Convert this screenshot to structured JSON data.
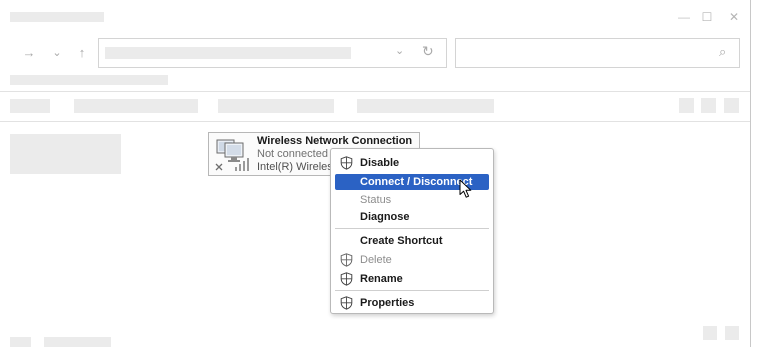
{
  "titlebar": {
    "minimize_glyph": "—",
    "maximize_glyph": "☐",
    "close_glyph": "✕"
  },
  "navigation": {
    "forward_glyph": "→",
    "recent_glyph": "⌄",
    "up_glyph": "↑",
    "dropdown_glyph": "⌄",
    "refresh_glyph": "↻",
    "search_glyph": "⌕"
  },
  "network": {
    "name": "Wireless Network Connection",
    "status": "Not connected",
    "device": "Intel(R) Wireless"
  },
  "context_menu": {
    "items": [
      {
        "label": "Disable",
        "icon": "shield-icon",
        "enabled": true
      },
      {
        "label": "Connect / Disconnect",
        "icon": "",
        "enabled": true,
        "highlighted": true
      },
      {
        "label": "Status",
        "icon": "",
        "enabled": false
      },
      {
        "label": "Diagnose",
        "icon": "",
        "enabled": true
      },
      {
        "label": "Create Shortcut",
        "icon": "",
        "enabled": true
      },
      {
        "label": "Delete",
        "icon": "shield-icon",
        "enabled": false
      },
      {
        "label": "Rename",
        "icon": "shield-icon",
        "enabled": true
      },
      {
        "label": "Properties",
        "icon": "shield-icon",
        "enabled": true
      }
    ]
  },
  "colors": {
    "highlight": "#2b62c4",
    "placeholder": "#ebebeb",
    "border": "#b9b9b9"
  }
}
